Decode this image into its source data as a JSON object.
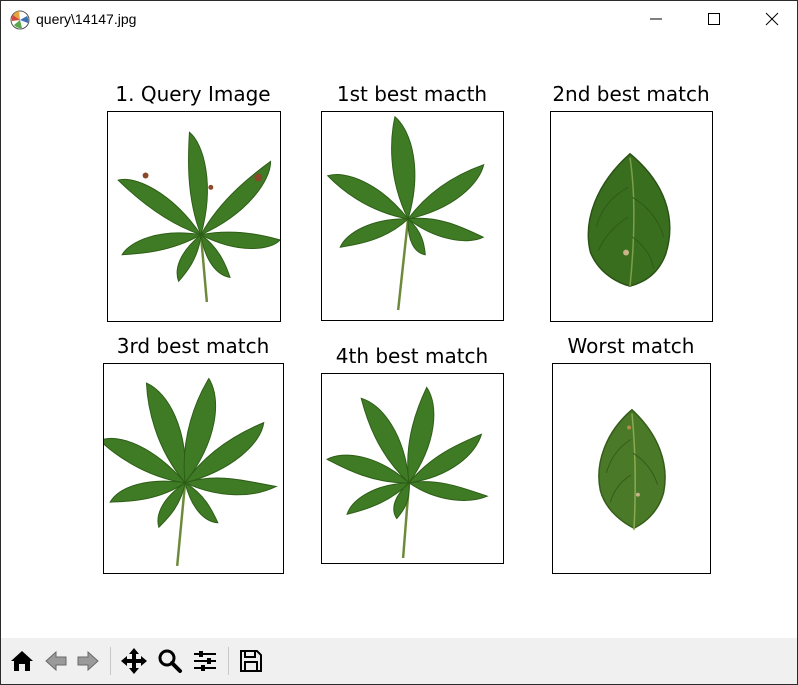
{
  "window": {
    "title": "query\\14147.jpg"
  },
  "figure": {
    "panels": [
      {
        "title": "1. Query Image",
        "image": "horse-chestnut-leaf-query"
      },
      {
        "title": "1st best macth",
        "image": "horse-chestnut-leaf-match-1"
      },
      {
        "title": "2nd best match",
        "image": "ovate-leaf-match-2"
      },
      {
        "title": "3rd best match",
        "image": "horse-chestnut-leaf-match-3"
      },
      {
        "title": "4th best match",
        "image": "horse-chestnut-leaf-match-4"
      },
      {
        "title": "Worst match",
        "image": "ovate-leaf-worst"
      }
    ]
  },
  "toolbar": {
    "buttons": [
      "home-icon",
      "back-icon",
      "forward-icon",
      "pan-icon",
      "zoom-icon",
      "configure-subplots-icon",
      "save-icon"
    ]
  },
  "colors": {
    "toolbar_bg": "#f0f0f0",
    "leaf_green": "#3f7a25",
    "leaf_dark": "#2d5e17"
  }
}
